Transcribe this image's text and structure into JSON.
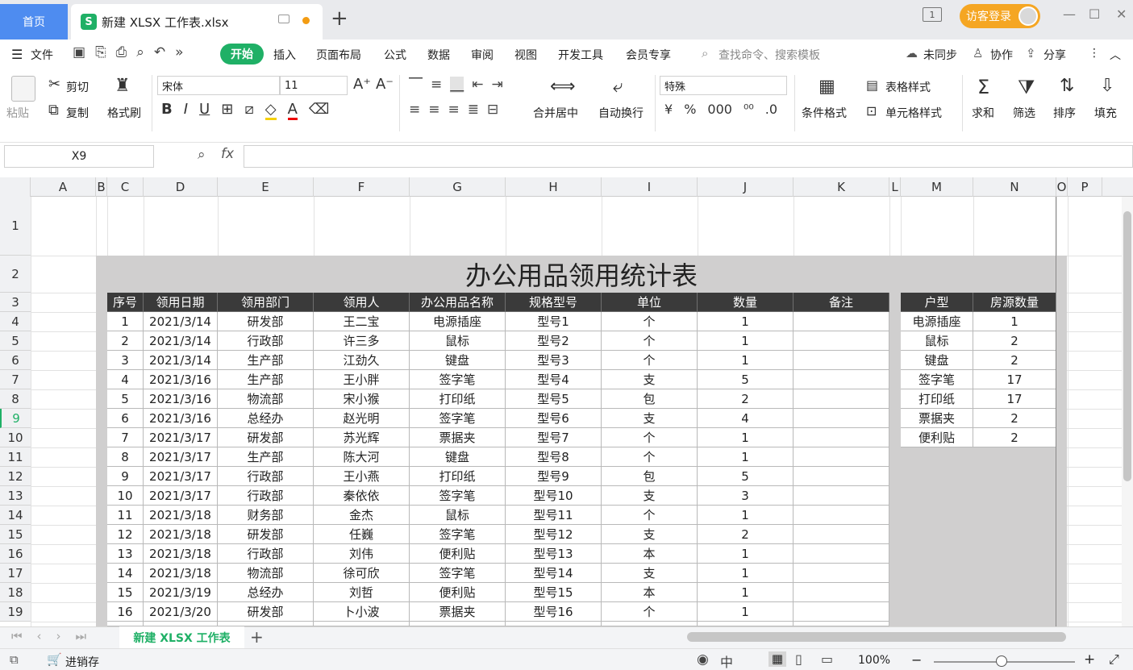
{
  "tabs": {
    "home": "首页",
    "doc": "新建 XLSX 工作表.xlsx",
    "login": "访客登录"
  },
  "menu": {
    "file": "文件",
    "items": [
      "开始",
      "插入",
      "页面布局",
      "公式",
      "数据",
      "审阅",
      "视图",
      "开发工具",
      "会员专享"
    ],
    "search": "查找命令、搜索模板",
    "sync": "未同步",
    "collab": "协作",
    "share": "分享"
  },
  "ribbon": {
    "paste": "粘贴",
    "cut": "剪切",
    "copy": "复制",
    "format_painter": "格式刷",
    "font": "宋体",
    "size": "11",
    "merge": "合并居中",
    "wrap": "自动换行",
    "numfmt": "特殊",
    "cond": "条件格式",
    "table_style": "表格样式",
    "cell_style": "单元格样式",
    "sum": "求和",
    "filter": "筛选",
    "sort": "排序",
    "fill": "填充"
  },
  "formula": {
    "namebox": "X9",
    "fx": "fx"
  },
  "columns": [
    "A",
    "B",
    "C",
    "D",
    "E",
    "F",
    "G",
    "H",
    "I",
    "J",
    "K",
    "L",
    "M",
    "N",
    "O",
    "P"
  ],
  "rows": [
    "1",
    "2",
    "3",
    "4",
    "5",
    "6",
    "7",
    "8",
    "9",
    "10",
    "11",
    "12",
    "13",
    "14",
    "15",
    "16",
    "17",
    "18",
    "19"
  ],
  "sheet_title": "办公用品领用统计表",
  "main_headers": [
    "序号",
    "领用日期",
    "领用部门",
    "领用人",
    "办公用品名称",
    "规格型号",
    "单位",
    "数量",
    "备注"
  ],
  "main_rows": [
    [
      "1",
      "2021/3/14",
      "研发部",
      "王二宝",
      "电源插座",
      "型号1",
      "个",
      "1",
      ""
    ],
    [
      "2",
      "2021/3/14",
      "行政部",
      "许三多",
      "鼠标",
      "型号2",
      "个",
      "1",
      ""
    ],
    [
      "3",
      "2021/3/14",
      "生产部",
      "江劲久",
      "键盘",
      "型号3",
      "个",
      "1",
      ""
    ],
    [
      "4",
      "2021/3/16",
      "生产部",
      "王小胖",
      "签字笔",
      "型号4",
      "支",
      "5",
      ""
    ],
    [
      "5",
      "2021/3/16",
      "物流部",
      "宋小猴",
      "打印纸",
      "型号5",
      "包",
      "2",
      ""
    ],
    [
      "6",
      "2021/3/16",
      "总经办",
      "赵光明",
      "签字笔",
      "型号6",
      "支",
      "4",
      ""
    ],
    [
      "7",
      "2021/3/17",
      "研发部",
      "苏光辉",
      "票据夹",
      "型号7",
      "个",
      "1",
      ""
    ],
    [
      "8",
      "2021/3/17",
      "生产部",
      "陈大河",
      "键盘",
      "型号8",
      "个",
      "1",
      ""
    ],
    [
      "9",
      "2021/3/17",
      "行政部",
      "王小燕",
      "打印纸",
      "型号9",
      "包",
      "5",
      ""
    ],
    [
      "10",
      "2021/3/17",
      "行政部",
      "秦依依",
      "签字笔",
      "型号10",
      "支",
      "3",
      ""
    ],
    [
      "11",
      "2021/3/18",
      "财务部",
      "金杰",
      "鼠标",
      "型号11",
      "个",
      "1",
      ""
    ],
    [
      "12",
      "2021/3/18",
      "研发部",
      "任巍",
      "签字笔",
      "型号12",
      "支",
      "2",
      ""
    ],
    [
      "13",
      "2021/3/18",
      "行政部",
      "刘伟",
      "便利贴",
      "型号13",
      "本",
      "1",
      ""
    ],
    [
      "14",
      "2021/3/18",
      "物流部",
      "徐可欣",
      "签字笔",
      "型号14",
      "支",
      "1",
      ""
    ],
    [
      "15",
      "2021/3/19",
      "总经办",
      "刘哲",
      "便利贴",
      "型号15",
      "本",
      "1",
      ""
    ],
    [
      "16",
      "2021/3/20",
      "研发部",
      "卜小波",
      "票据夹",
      "型号16",
      "个",
      "1",
      ""
    ]
  ],
  "side_headers": [
    "户型",
    "房源数量"
  ],
  "side_rows": [
    [
      "电源插座",
      "1"
    ],
    [
      "鼠标",
      "2"
    ],
    [
      "键盘",
      "2"
    ],
    [
      "签字笔",
      "17"
    ],
    [
      "打印纸",
      "17"
    ],
    [
      "票据夹",
      "2"
    ],
    [
      "便利贴",
      "2"
    ]
  ],
  "bottom": {
    "sheet": "新建 XLSX 工作表",
    "status": "进销存",
    "zoom": "100%"
  }
}
